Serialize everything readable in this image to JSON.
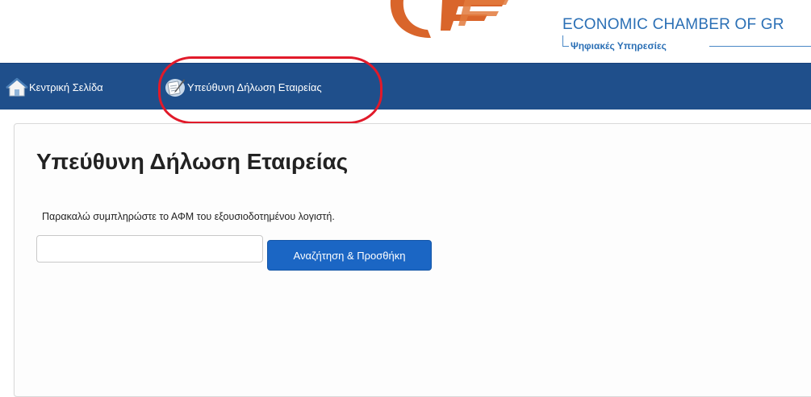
{
  "header": {
    "org_name": "ECONOMIC CHAMBER OF GR",
    "org_subtitle": "Ψηφιακές Υπηρεσίες",
    "brand_colors": {
      "logo_orange": "#d9652b",
      "text_blue": "#2a6fb5"
    }
  },
  "navbar": {
    "background": "#1f4f8b",
    "items": [
      {
        "label": "Κεντρική Σελίδα",
        "icon": "home-icon"
      },
      {
        "label": "Υπεύθυνη Δήλωση Εταιρείας",
        "icon": "document-quill-icon"
      }
    ],
    "highlight_color": "#e11a2a"
  },
  "main": {
    "title": "Υπεύθυνη Δήλωση Εταιρείας",
    "instruction": "Παρακαλώ συμπληρώστε το ΑΦΜ του εξουσιοδοτημένου λογιστή.",
    "afm_input": {
      "value": "",
      "placeholder": ""
    },
    "search_button_label": "Αναζήτηση & Προσθήκη",
    "button_color": "#1b66c4"
  }
}
